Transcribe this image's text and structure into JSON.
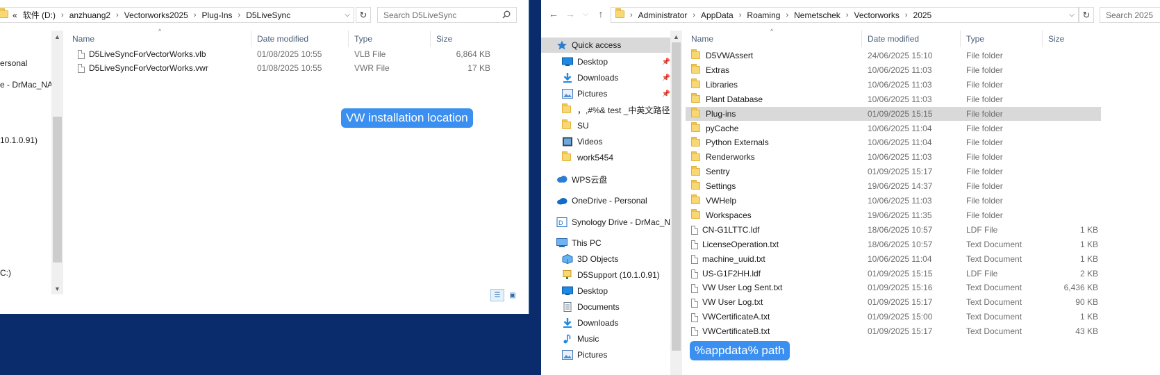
{
  "left_window": {
    "breadcrumb": [
      "«",
      "软件 (D:)",
      "anzhuang2",
      "Vectorworks2025",
      "Plug-Ins",
      "D5LiveSync"
    ],
    "search_placeholder": "Search D5LiveSync",
    "nav_fragments": [
      "ersonal",
      "e - DrMac_NA",
      "10.1.0.91)",
      "C:)"
    ],
    "columns": {
      "name": "Name",
      "date": "Date modified",
      "type": "Type",
      "size": "Size"
    },
    "files": [
      {
        "name": "D5LiveSyncForVectorWorks.vlb",
        "date": "01/08/2025 10:55",
        "type": "VLB File",
        "size": "6,864 KB"
      },
      {
        "name": "D5LiveSyncForVectorWorks.vwr",
        "date": "01/08/2025 10:55",
        "type": "VWR File",
        "size": "17 KB"
      }
    ],
    "callout": "VW installation location"
  },
  "right_window": {
    "breadcrumb": [
      "Administrator",
      "AppData",
      "Roaming",
      "Nemetschek",
      "Vectorworks",
      "2025"
    ],
    "search_placeholder": "Search 2025",
    "nav": {
      "quick_access": "Quick access",
      "qa_items": [
        {
          "label": "Desktop",
          "icon": "desktop-icon",
          "pinned": true
        },
        {
          "label": "Downloads",
          "icon": "downloads-icon",
          "pinned": true
        },
        {
          "label": "Pictures",
          "icon": "pictures-icon",
          "pinned": true
        },
        {
          "label": "，,#%& test _中英文路径",
          "icon": "folder-icon",
          "pinned": false
        },
        {
          "label": "SU",
          "icon": "folder-icon",
          "pinned": false
        },
        {
          "label": "Videos",
          "icon": "videos-icon",
          "pinned": false
        },
        {
          "label": "work5454",
          "icon": "folder-icon",
          "pinned": false
        }
      ],
      "wps": "WPS云盘",
      "onedrive": "OneDrive - Personal",
      "synology": "Synology Drive - DrMac_NA",
      "this_pc": "This PC",
      "pc_items": [
        {
          "label": "3D Objects",
          "icon": "3d-objects-icon"
        },
        {
          "label": "D5Support (10.1.0.91)",
          "icon": "network-drive-icon"
        },
        {
          "label": "Desktop",
          "icon": "desktop-icon"
        },
        {
          "label": "Documents",
          "icon": "documents-icon"
        },
        {
          "label": "Downloads",
          "icon": "downloads-icon"
        },
        {
          "label": "Music",
          "icon": "music-icon"
        },
        {
          "label": "Pictures",
          "icon": "pictures-icon"
        }
      ]
    },
    "columns": {
      "name": "Name",
      "date": "Date modified",
      "type": "Type",
      "size": "Size"
    },
    "files": [
      {
        "name": "D5VWAssert",
        "date": "24/06/2025 15:10",
        "type": "File folder",
        "size": "",
        "kind": "folder"
      },
      {
        "name": "Extras",
        "date": "10/06/2025 11:03",
        "type": "File folder",
        "size": "",
        "kind": "folder"
      },
      {
        "name": "Libraries",
        "date": "10/06/2025 11:03",
        "type": "File folder",
        "size": "",
        "kind": "folder"
      },
      {
        "name": "Plant Database",
        "date": "10/06/2025 11:03",
        "type": "File folder",
        "size": "",
        "kind": "folder"
      },
      {
        "name": "Plug-ins",
        "date": "01/09/2025 15:15",
        "type": "File folder",
        "size": "",
        "kind": "folder",
        "selected": true
      },
      {
        "name": "pyCache",
        "date": "10/06/2025 11:04",
        "type": "File folder",
        "size": "",
        "kind": "folder"
      },
      {
        "name": "Python Externals",
        "date": "10/06/2025 11:04",
        "type": "File folder",
        "size": "",
        "kind": "folder"
      },
      {
        "name": "Renderworks",
        "date": "10/06/2025 11:03",
        "type": "File folder",
        "size": "",
        "kind": "folder"
      },
      {
        "name": "Sentry",
        "date": "01/09/2025 15:17",
        "type": "File folder",
        "size": "",
        "kind": "folder"
      },
      {
        "name": "Settings",
        "date": "19/06/2025 14:37",
        "type": "File folder",
        "size": "",
        "kind": "folder"
      },
      {
        "name": "VWHelp",
        "date": "10/06/2025 11:03",
        "type": "File folder",
        "size": "",
        "kind": "folder"
      },
      {
        "name": "Workspaces",
        "date": "19/06/2025 11:35",
        "type": "File folder",
        "size": "",
        "kind": "folder"
      },
      {
        "name": "CN-G1LTTC.ldf",
        "date": "18/06/2025 10:57",
        "type": "LDF File",
        "size": "1 KB",
        "kind": "file"
      },
      {
        "name": "LicenseOperation.txt",
        "date": "18/06/2025 10:57",
        "type": "Text Document",
        "size": "1 KB",
        "kind": "file"
      },
      {
        "name": "machine_uuid.txt",
        "date": "10/06/2025 11:04",
        "type": "Text Document",
        "size": "1 KB",
        "kind": "file"
      },
      {
        "name": "US-G1F2HH.ldf",
        "date": "01/09/2025 15:15",
        "type": "LDF File",
        "size": "2 KB",
        "kind": "file"
      },
      {
        "name": "VW User Log Sent.txt",
        "date": "01/09/2025 15:16",
        "type": "Text Document",
        "size": "6,436 KB",
        "kind": "file"
      },
      {
        "name": "VW User Log.txt",
        "date": "01/09/2025 15:17",
        "type": "Text Document",
        "size": "90 KB",
        "kind": "file"
      },
      {
        "name": "VWCertificateA.txt",
        "date": "01/09/2025 15:00",
        "type": "Text Document",
        "size": "1 KB",
        "kind": "file"
      },
      {
        "name": "VWCertificateB.txt",
        "date": "01/09/2025 15:17",
        "type": "Text Document",
        "size": "43 KB",
        "kind": "file"
      }
    ],
    "callout": "%appdata% path"
  }
}
